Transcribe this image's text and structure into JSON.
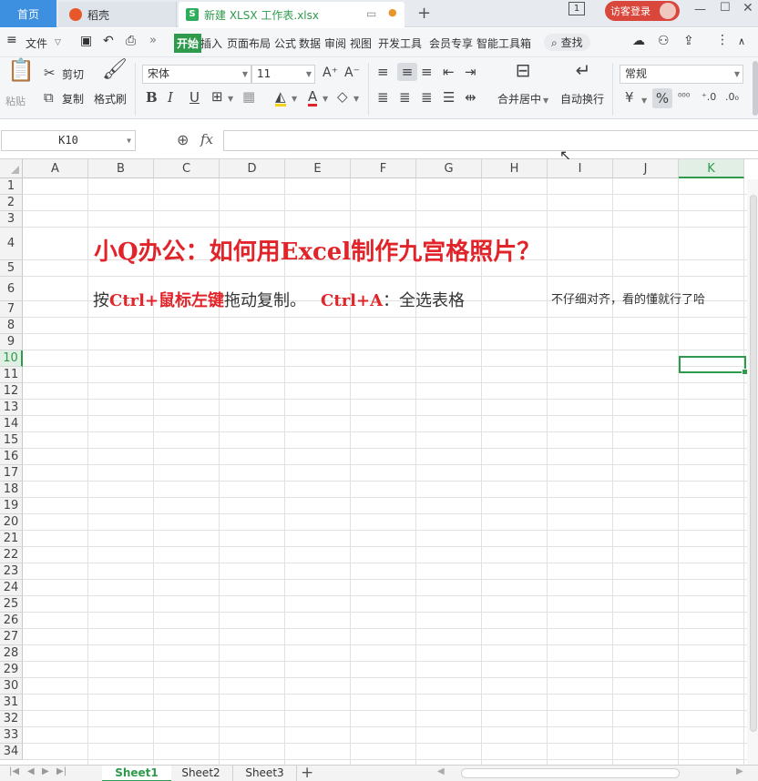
{
  "titlebar": {
    "tabs": [
      "首页",
      "稻壳",
      "新建 XLSX 工作表.xlsx"
    ],
    "page_badge": "1",
    "guest_login": "访客登录"
  },
  "menubar": {
    "file_label": "文件",
    "items": [
      "开始",
      "插入",
      "页面布局",
      "公式",
      "数据",
      "审阅",
      "视图",
      "开发工具",
      "会员专享",
      "智能工具箱"
    ],
    "search_label": "查找",
    "active_item": "开始"
  },
  "ribbon": {
    "paste": "粘贴",
    "cut": "剪切",
    "copy": "复制",
    "format_painter": "格式刷",
    "font_name": "宋体",
    "font_size": "11",
    "merge_center": "合并居中",
    "auto_wrap": "自动换行",
    "number_format": "常规",
    "currency_symbol": "¥",
    "percent_symbol": "%"
  },
  "formula_bar": {
    "cell_ref": "K10",
    "fx": "fx",
    "formula": ""
  },
  "sheet": {
    "columns": [
      "A",
      "B",
      "C",
      "D",
      "E",
      "F",
      "G",
      "H",
      "I",
      "J",
      "K"
    ],
    "selected_column": "K",
    "rows": [
      "1",
      "2",
      "3",
      "4",
      "5",
      "6",
      "7",
      "8",
      "9",
      "10",
      "11",
      "12",
      "13",
      "14",
      "15",
      "16",
      "17",
      "18",
      "19",
      "20",
      "21",
      "22",
      "23",
      "24",
      "25",
      "26",
      "27",
      "28",
      "29",
      "30",
      "31",
      "32",
      "33",
      "34"
    ],
    "selected_row": "10",
    "title_cell": "小Q办公：如何用Excel制作九宫格照片？",
    "row6": {
      "p1": "按",
      "p2": "Ctrl+鼠标左键",
      "p3": "拖动复制。",
      "p4": "Ctrl+A",
      "p5": "：全选表格",
      "note": "不仔细对齐，看的懂就行了哈"
    }
  },
  "sheet_tabs": [
    "Sheet1",
    "Sheet2",
    "Sheet3"
  ],
  "add_sheet": "+",
  "colors": {
    "accent": "#2e9a4c",
    "title_red": "#e1242a",
    "home_tab": "#3d8fe0",
    "guest_button": "#d9463b"
  }
}
